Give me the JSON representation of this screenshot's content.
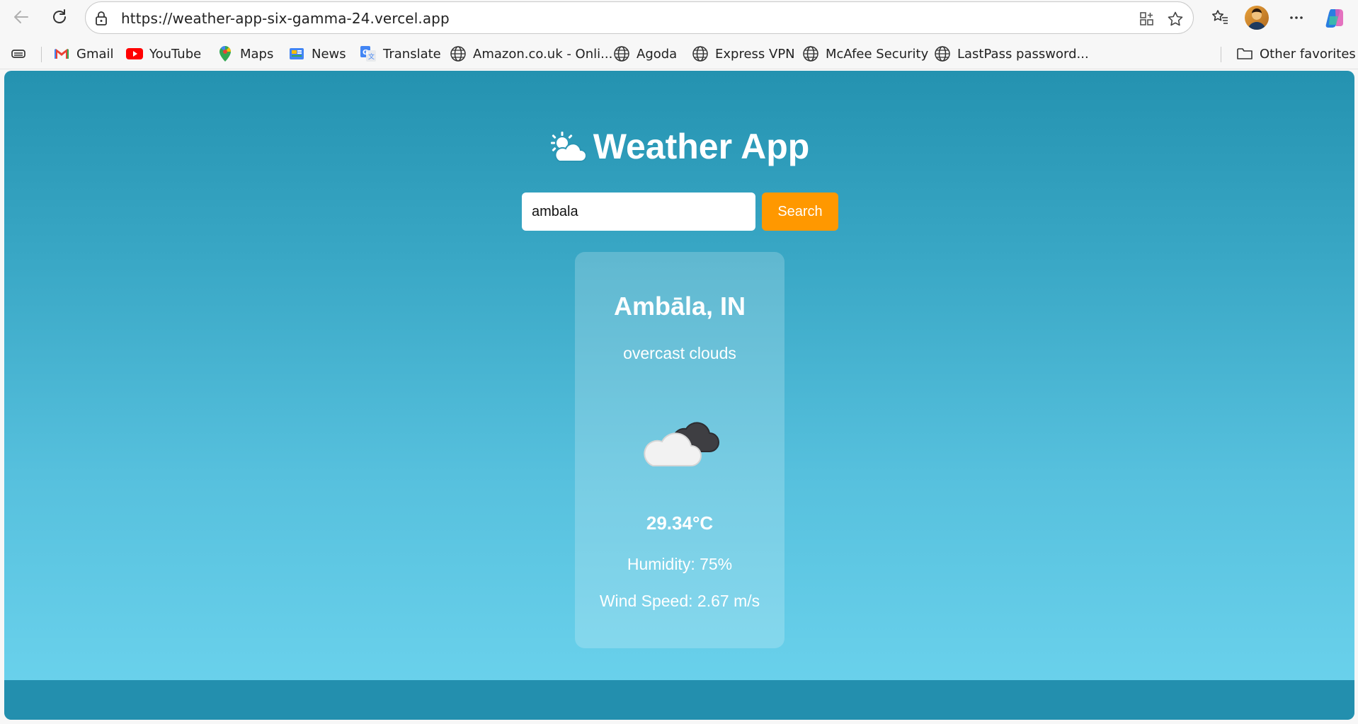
{
  "browser": {
    "url": "https://weather-app-six-gamma-24.vercel.app",
    "bookmarks": [
      {
        "label": "Gmail",
        "icon": "gmail-icon"
      },
      {
        "label": "YouTube",
        "icon": "youtube-icon"
      },
      {
        "label": "Maps",
        "icon": "maps-icon"
      },
      {
        "label": "News",
        "icon": "news-icon"
      },
      {
        "label": "Translate",
        "icon": "translate-icon"
      },
      {
        "label": "Amazon.co.uk - Onli...",
        "icon": "globe-icon"
      },
      {
        "label": "Agoda",
        "icon": "globe-icon"
      },
      {
        "label": "Express VPN",
        "icon": "globe-icon"
      },
      {
        "label": "McAfee Security",
        "icon": "globe-icon"
      },
      {
        "label": "LastPass password...",
        "icon": "globe-icon"
      }
    ],
    "other_favorites": "Other favorites"
  },
  "app": {
    "title": "Weather App",
    "title_icon": "sun-behind-cloud-icon",
    "search": {
      "value": "ambala",
      "button_label": "Search"
    },
    "result": {
      "city": "Ambāla, IN",
      "description": "overcast clouds",
      "icon": "overcast-clouds-icon",
      "temperature": "29.34°C",
      "humidity": "Humidity: 75%",
      "wind_speed": "Wind Speed: 2.67 m/s"
    }
  },
  "colors": {
    "accent_button": "#ff9800",
    "background_top": "#2492b0",
    "background_bottom": "#6dd4ee",
    "footer_band": "#238fae"
  }
}
